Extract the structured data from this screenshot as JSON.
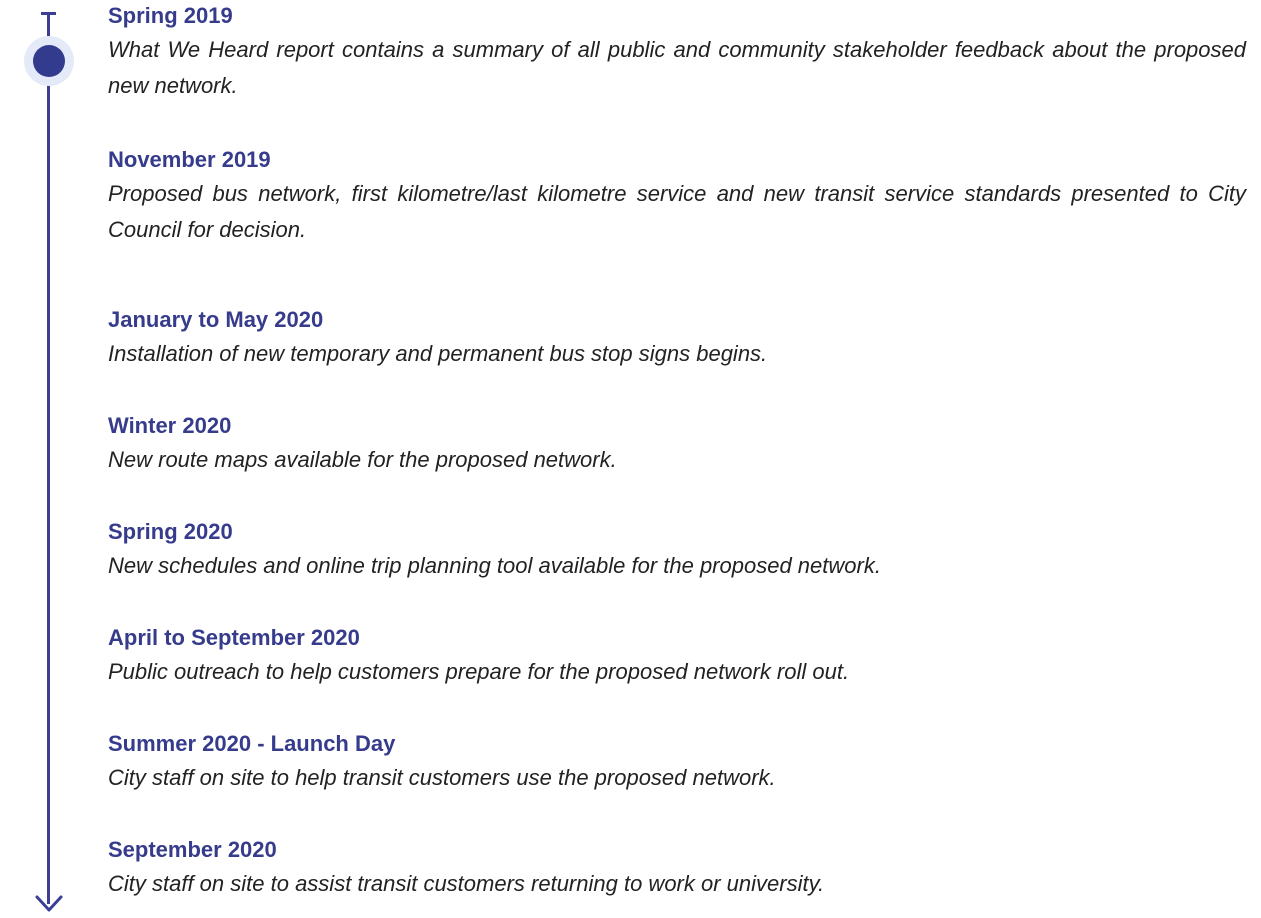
{
  "colors": {
    "accent": "#363b8c",
    "line": "#3a3f95",
    "halo": "#e4eaf8",
    "text": "#222222"
  },
  "timeline": {
    "icons": {
      "start": "timeline-start-cap-icon",
      "marker": "timeline-current-marker-icon",
      "end": "timeline-arrow-down-icon"
    },
    "entries": [
      {
        "date": "Spring 2019",
        "description": "What We Heard report contains a summary of all public and community stakeholder feedback about the proposed new network."
      },
      {
        "date": "November 2019",
        "description": "Proposed bus network, first kilometre/last kilometre service and new transit service standards presented to City Council for decision."
      },
      {
        "date": "January to May 2020",
        "description": "Installation of new temporary and permanent bus stop signs begins."
      },
      {
        "date": "Winter 2020",
        "description": "New route maps available for the proposed network."
      },
      {
        "date": "Spring 2020",
        "description": "New schedules and online trip planning tool available for the proposed network."
      },
      {
        "date": "April to September 2020",
        "description": "Public outreach to help customers prepare for the proposed network roll out."
      },
      {
        "date": "Summer 2020 - Launch Day",
        "description": "City staff on site to help transit customers use the proposed network."
      },
      {
        "date": "September 2020",
        "description": "City staff on site to assist transit customers returning to work or university."
      }
    ]
  }
}
